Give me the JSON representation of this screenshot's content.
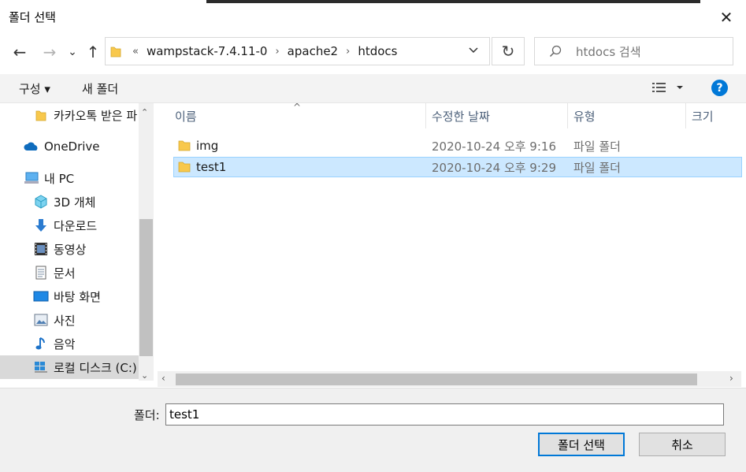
{
  "window": {
    "title": "폴더 선택",
    "close": "✕"
  },
  "nav": {
    "back": "←",
    "forward": "→",
    "recent": "⌄",
    "up": "↑",
    "breadcrumbs": [
      "wampstack-7.4.11-0",
      "apache2",
      "htdocs"
    ],
    "overflow": "«",
    "refresh": "↻",
    "search_placeholder": "htdocs 검색"
  },
  "toolbar": {
    "organize": "구성 ▾",
    "new_folder": "새 폴더",
    "help": "?"
  },
  "sidebar": {
    "items": [
      {
        "label": "카카오톡 받은 파",
        "icon": "folder-icon"
      },
      {
        "label": "OneDrive",
        "icon": "onedrive-icon"
      },
      {
        "label": "내 PC",
        "icon": "pc-icon"
      },
      {
        "label": "3D 개체",
        "icon": "3d-objects-icon"
      },
      {
        "label": "다운로드",
        "icon": "download-icon"
      },
      {
        "label": "동영상",
        "icon": "video-icon"
      },
      {
        "label": "문서",
        "icon": "document-icon"
      },
      {
        "label": "바탕 화면",
        "icon": "desktop-icon"
      },
      {
        "label": "사진",
        "icon": "pictures-icon"
      },
      {
        "label": "음악",
        "icon": "music-icon"
      },
      {
        "label": "로컬 디스크 (C:)",
        "icon": "drive-icon"
      }
    ]
  },
  "columns": {
    "name": "이름",
    "date": "수정한 날짜",
    "type": "유형",
    "size": "크기"
  },
  "files": [
    {
      "name": "img",
      "date": "2020-10-24 오후 9:16",
      "type": "파일 폴더",
      "selected": false
    },
    {
      "name": "test1",
      "date": "2020-10-24 오후 9:29",
      "type": "파일 폴더",
      "selected": true
    }
  ],
  "footer": {
    "folder_label": "폴더:",
    "folder_value": "test1",
    "select_button": "폴더 선택",
    "cancel_button": "취소"
  },
  "colors": {
    "accent": "#0078d7",
    "selection": "#cce8ff",
    "folder": "#f8c84c"
  }
}
